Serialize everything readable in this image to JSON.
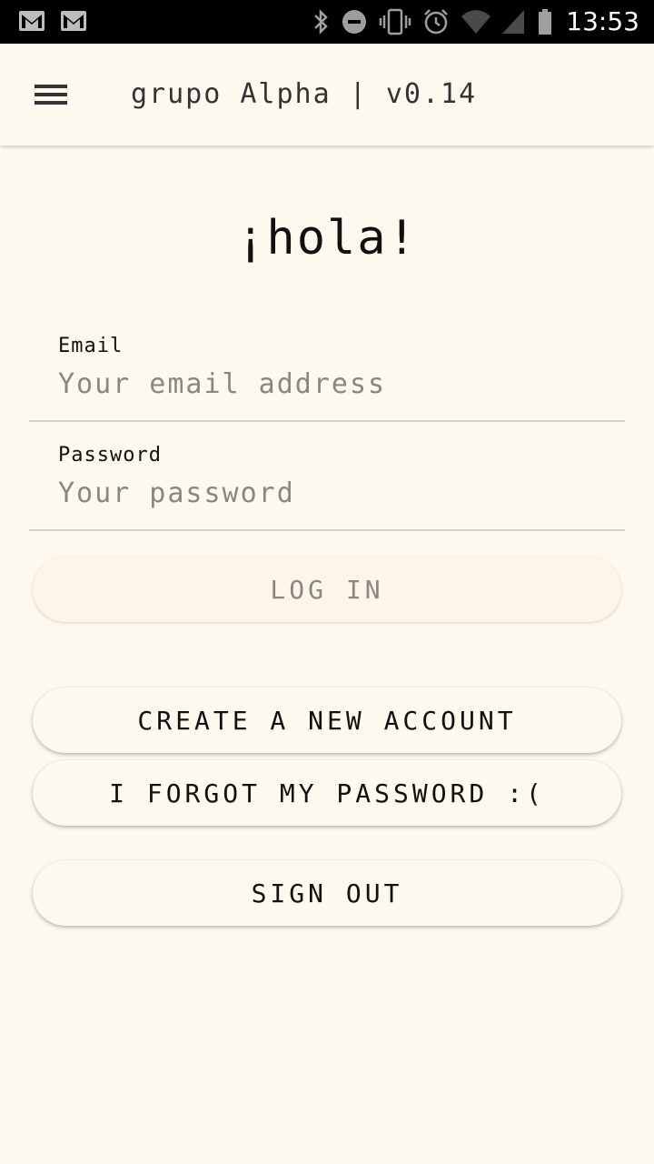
{
  "status_bar": {
    "left_icons": [
      "gmail-icon",
      "gmail-icon"
    ],
    "right_icons": [
      "bluetooth-icon",
      "do-not-disturb-icon",
      "vibrate-icon",
      "alarm-icon",
      "wifi-icon",
      "signal-icon",
      "battery-icon"
    ],
    "time": "13:53"
  },
  "app_bar": {
    "menu_icon": "hamburger-menu-icon",
    "title": "grupo Alpha | v0.14"
  },
  "greeting": "¡hola!",
  "email": {
    "label": "Email",
    "placeholder": "Your email address",
    "value": ""
  },
  "password": {
    "label": "Password",
    "placeholder": "Your password",
    "value": ""
  },
  "buttons": {
    "log_in": "LOG IN",
    "create_account": "CREATE A NEW ACCOUNT",
    "forgot_password": "I FORGOT MY PASSWORD :(",
    "sign_out": "SIGN OUT"
  },
  "colors": {
    "background": "#fdf9ee",
    "status_bar": "#000000",
    "text": "#111111",
    "placeholder": "#8a8780",
    "disabled_text": "#8c8880"
  }
}
